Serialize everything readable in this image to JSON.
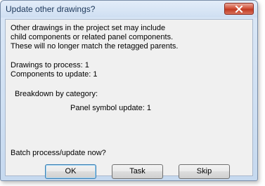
{
  "window": {
    "title": "Update other drawings?",
    "close_icon": "close-icon"
  },
  "message": {
    "line1": "Other drawings in the project set may include",
    "line2": "child components or related panel components.",
    "line3": "These will no longer match the retagged parents."
  },
  "stats": {
    "drawings_to_process": "Drawings to process: 1",
    "components_to_update": "Components to update: 1"
  },
  "breakdown": {
    "heading": "Breakdown by category:",
    "panel_symbol": "Panel symbol update: 1"
  },
  "prompt": "Batch process/update now?",
  "buttons": {
    "ok": "OK",
    "task": "Task",
    "skip": "Skip"
  },
  "colors": {
    "title_text": "#1e395b",
    "close_button": "#c13a22",
    "client_bg": "#f0f0f0"
  }
}
